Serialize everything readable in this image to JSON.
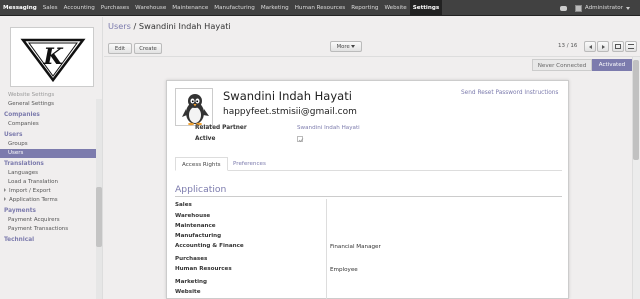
{
  "topnav": {
    "items": [
      "Messaging",
      "Sales",
      "Accounting",
      "Purchases",
      "Warehouse",
      "Maintenance",
      "Manufacturing",
      "Marketing",
      "Human Resources",
      "Reporting",
      "Website",
      "Settings"
    ],
    "user": "Administrator"
  },
  "sidebar": {
    "logo_letter": "K",
    "rows": [
      {
        "type": "item",
        "label": "Website Settings",
        "cut": true
      },
      {
        "type": "item",
        "label": "General Settings"
      },
      {
        "type": "head",
        "label": "Companies"
      },
      {
        "type": "item",
        "label": "Companies"
      },
      {
        "type": "head",
        "label": "Users"
      },
      {
        "type": "item",
        "label": "Groups"
      },
      {
        "type": "item",
        "label": "Users",
        "active": true
      },
      {
        "type": "head",
        "label": "Translations"
      },
      {
        "type": "item",
        "label": "Languages"
      },
      {
        "type": "item",
        "label": "Load a Translation"
      },
      {
        "type": "sub",
        "label": "Import / Export"
      },
      {
        "type": "sub",
        "label": "Application Terms"
      },
      {
        "type": "head",
        "label": "Payments"
      },
      {
        "type": "item",
        "label": "Payment Acquirers"
      },
      {
        "type": "item",
        "label": "Payment Transactions"
      },
      {
        "type": "head",
        "label": "Technical"
      }
    ]
  },
  "breadcrumb": {
    "parent": "Users",
    "separator": "/",
    "current": "Swandini Indah Hayati"
  },
  "toolbar": {
    "edit": "Edit",
    "create": "Create",
    "more": "More",
    "pager": "13 / 16"
  },
  "status": {
    "stages": [
      "Never Connected",
      "Activated"
    ],
    "active": "Activated"
  },
  "form": {
    "name": "Swandini Indah Hayati",
    "email": "happyfeet.stmisii@gmail.com",
    "reset_link": "Send Reset Password Instructions",
    "related_partner_label": "Related Partner",
    "related_partner_value": "Swandini Indah Hayati",
    "active_label": "Active",
    "active_checked": true,
    "tabs": [
      "Access Rights",
      "Preferences"
    ],
    "section_title": "Application",
    "apps": [
      {
        "name": "Sales",
        "value": ""
      },
      {
        "name": "Warehouse",
        "value": ""
      },
      {
        "name": "Maintenance",
        "value": ""
      },
      {
        "name": "Manufacturing",
        "value": ""
      },
      {
        "name": "Accounting & Finance",
        "value": "Financial Manager"
      },
      {
        "name": "Purchases",
        "value": ""
      },
      {
        "name": "Human Resources",
        "value": "Employee"
      },
      {
        "name": "Marketing",
        "value": ""
      },
      {
        "name": "Website",
        "value": ""
      }
    ]
  },
  "colors": {
    "accent": "#7c7bad",
    "topbar": "#414141"
  }
}
